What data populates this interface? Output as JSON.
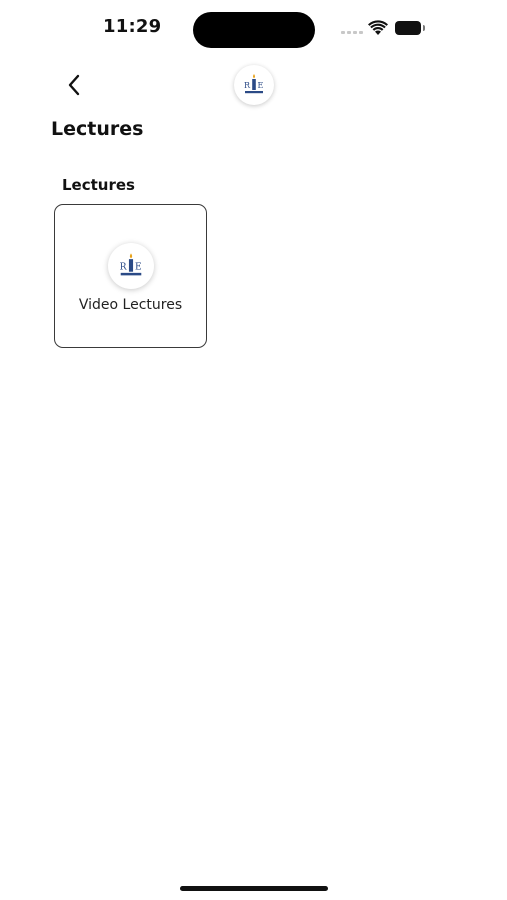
{
  "status_bar": {
    "time": "11:29",
    "icons": [
      "signal-dots-icon",
      "wifi-icon",
      "battery-icon"
    ]
  },
  "header": {
    "back_icon": "chevron-left-icon",
    "logo_text": "RIE"
  },
  "page": {
    "title": "Lectures"
  },
  "section": {
    "title": "Lectures",
    "cards": [
      {
        "label": "Video Lectures",
        "logo_text": "RIE"
      }
    ]
  },
  "colors": {
    "background": "#ffffff",
    "text": "#111111",
    "logo_blue": "#2b4a86",
    "logo_gold": "#e8a21a"
  }
}
